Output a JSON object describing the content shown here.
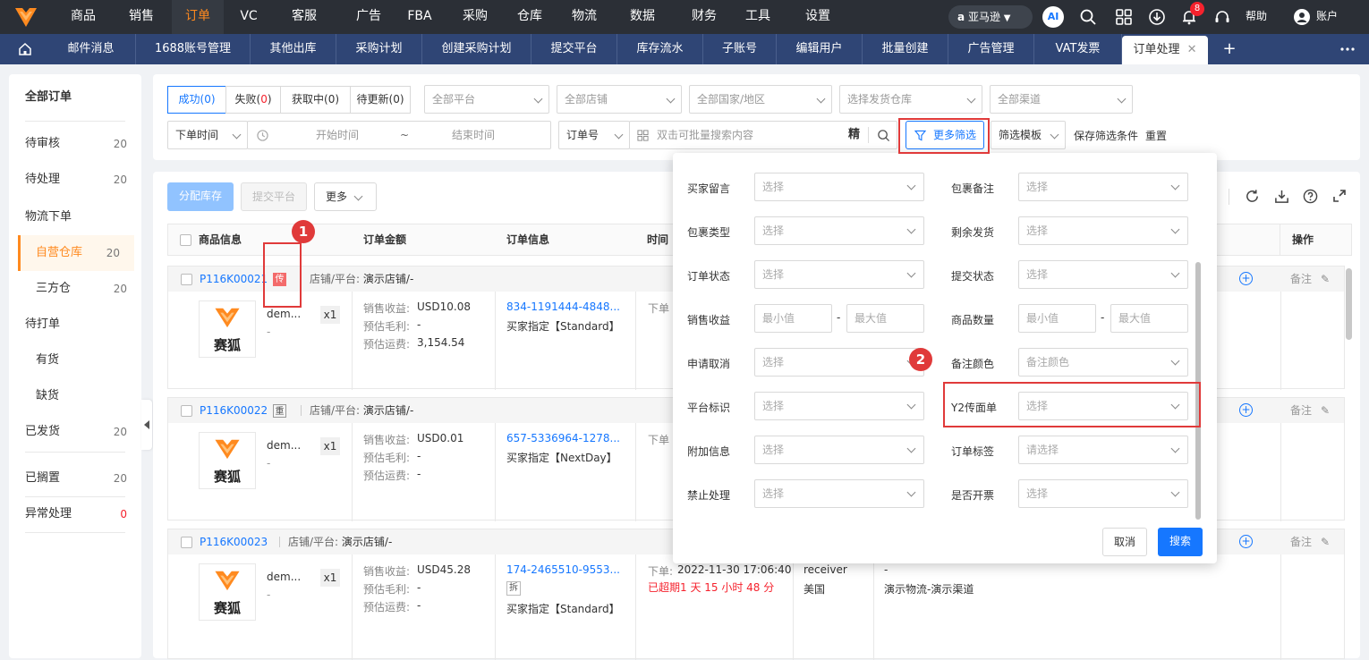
{
  "topnav": {
    "items": [
      "商品",
      "销售",
      "订单",
      "VC",
      "客服",
      "广告",
      "FBA",
      "采购",
      "仓库",
      "物流",
      "数据",
      "财务",
      "工具",
      "设置"
    ],
    "active": "订单",
    "marketplace": "亚马逊",
    "ai_label": "AI",
    "notification_count": "8",
    "help_label": "帮助",
    "account_label": "账户"
  },
  "tabs": {
    "items": [
      "邮件消息",
      "1688账号管理",
      "其他出库",
      "采购计划",
      "创建采购计划",
      "提交平台",
      "库存流水",
      "子账号",
      "编辑用户",
      "批量创建",
      "广告管理",
      "VAT发票"
    ],
    "active": "订单处理",
    "add_label": "+"
  },
  "sidebar": {
    "all_orders": "全部订单",
    "items": [
      {
        "label": "待审核",
        "count": "20"
      },
      {
        "label": "待处理",
        "count": "20"
      },
      {
        "label": "物流下单",
        "count": ""
      },
      {
        "label": "自营仓库",
        "count": "20"
      },
      {
        "label": "三方仓",
        "count": "20"
      },
      {
        "label": "待打单",
        "count": ""
      },
      {
        "label": "有货",
        "count": ""
      },
      {
        "label": "缺货",
        "count": ""
      },
      {
        "label": "已发货",
        "count": "20"
      },
      {
        "label": "已搁置",
        "count": "20"
      },
      {
        "label": "异常处理",
        "count": "0"
      }
    ]
  },
  "filters": {
    "status_tabs": [
      {
        "label": "成功",
        "count": "0"
      },
      {
        "label": "失败",
        "count": "0"
      },
      {
        "label": "获取中",
        "count": "0"
      },
      {
        "label": "待更新",
        "count": "0"
      }
    ],
    "platform_placeholder": "全部平台",
    "store_placeholder": "全部店铺",
    "country_placeholder": "全部国家/地区",
    "warehouse_placeholder": "选择发货仓库",
    "channel_placeholder": "全部渠道",
    "time_type": "下单时间",
    "start_placeholder": "开始时间",
    "range_sep": "~",
    "end_placeholder": "结束时间",
    "search_type": "订单号",
    "search_placeholder": "双击可批量搜索内容",
    "exact_label": "精",
    "more_filters": "更多筛选",
    "template_label": "筛选模板",
    "save_label": "保存筛选条件",
    "reset_label": "重置"
  },
  "toolbar": {
    "allocate": "分配库存",
    "submit": "提交平台",
    "more": "更多"
  },
  "table": {
    "headers": [
      "商品信息",
      "订单金额",
      "订单信息",
      "时间",
      "操作"
    ]
  },
  "orders": [
    {
      "id": "P116K00021",
      "tag": "传",
      "store_label": "店铺/平台:",
      "store": "演示店铺/-",
      "product": "dem...",
      "qty": "x1",
      "logo_text": "赛狐",
      "revenue_label": "销售收益:",
      "revenue": "USD10.08",
      "profit_label": "预估毛利:",
      "profit": "-",
      "freight_label": "预估运费:",
      "freight": "3,154.54",
      "order_no": "834-1191444-4848...",
      "ship": "买家指定【Standard】",
      "time_label": "下单"
    },
    {
      "id": "P116K00022",
      "tag": "重",
      "store_label": "店铺/平台:",
      "store": "演示店铺/-",
      "product": "dem...",
      "qty": "x1",
      "logo_text": "赛狐",
      "revenue_label": "销售收益:",
      "revenue": "USD0.01",
      "profit_label": "预估毛利:",
      "profit": "-",
      "freight_label": "预估运费:",
      "freight": "-",
      "order_no": "657-5336964-1278...",
      "ship": "买家指定【NextDay】",
      "time_label": "下单"
    },
    {
      "id": "P116K00023",
      "tag": "",
      "store_label": "店铺/平台:",
      "store": "演示店铺/-",
      "product": "dem...",
      "qty": "x1",
      "logo_text": "赛狐",
      "revenue_label": "销售收益:",
      "revenue": "USD45.28",
      "profit_label": "预估毛利:",
      "profit": "-",
      "freight_label": "预估运费:",
      "freight": "-",
      "order_no": "174-2465510-9553...",
      "split_tag": "拆",
      "ship": "买家指定【Standard】",
      "time_label": "下单:",
      "time": "2022-11-30 17:06:40",
      "overdue": "已超期1 天 15 小时 48 分",
      "receiver": "receiver",
      "country": "美国",
      "logistics_dash": "-",
      "logistics": "演示物流-演示渠道"
    }
  ],
  "row_ops": {
    "note": "备注"
  },
  "more_filter_panel": {
    "select_placeholder": "选择",
    "min_placeholder": "最小值",
    "max_placeholder": "最大值",
    "range_sep": "-",
    "left": [
      {
        "label": "买家留言",
        "type": "select"
      },
      {
        "label": "包裹类型",
        "type": "select"
      },
      {
        "label": "订单状态",
        "type": "select"
      },
      {
        "label": "销售收益",
        "type": "range"
      },
      {
        "label": "申请取消",
        "type": "select"
      },
      {
        "label": "平台标识",
        "type": "select"
      },
      {
        "label": "附加信息",
        "type": "select"
      },
      {
        "label": "禁止处理",
        "type": "select"
      }
    ],
    "right": [
      {
        "label": "包裹备注",
        "type": "select",
        "placeholder": "选择"
      },
      {
        "label": "剩余发货",
        "type": "select",
        "placeholder": "选择"
      },
      {
        "label": "提交状态",
        "type": "select",
        "placeholder": "选择"
      },
      {
        "label": "商品数量",
        "type": "range",
        "placeholder": ""
      },
      {
        "label": "备注颜色",
        "type": "select",
        "placeholder": "备注颜色"
      },
      {
        "label": "Y2传面单",
        "type": "select",
        "placeholder": "选择"
      },
      {
        "label": "订单标签",
        "type": "select",
        "placeholder": "请选择"
      },
      {
        "label": "是否开票",
        "type": "select",
        "placeholder": "选择"
      }
    ],
    "cancel": "取消",
    "search": "搜索"
  },
  "annotations": [
    "1",
    "2"
  ],
  "colors": {
    "accent": "#ff8a1f",
    "primary": "#1677ff",
    "topnav": "#2b2f36",
    "tabbar": "#2f4575",
    "highlight": "#e03a3a"
  }
}
